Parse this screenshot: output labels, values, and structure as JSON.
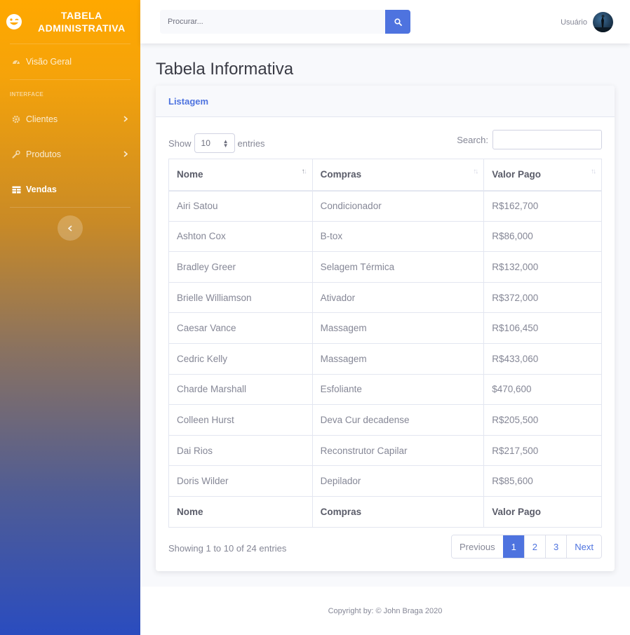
{
  "brand": {
    "line1": "TABELA",
    "line2": "ADMINISTRATIVA"
  },
  "sidebar": {
    "overview": "Visão Geral",
    "heading": "INTERFACE",
    "items": [
      {
        "label": "Clientes",
        "icon": "gear-icon",
        "has_chevron": true
      },
      {
        "label": "Produtos",
        "icon": "wrench-icon",
        "has_chevron": true
      },
      {
        "label": "Vendas",
        "icon": "table-icon",
        "active": true
      }
    ]
  },
  "topbar": {
    "search_placeholder": "Procurar...",
    "user_name": "Usuário"
  },
  "page": {
    "title": "Tabela Informativa"
  },
  "card": {
    "title": "Listagem",
    "length": {
      "show": "Show",
      "value": "10",
      "entries": "entries"
    },
    "search_label": "Search:",
    "columns": [
      "Nome",
      "Compras",
      "Valor Pago"
    ],
    "rows": [
      [
        "Airi Satou",
        "Condicionador",
        "R$162,700"
      ],
      [
        "Ashton Cox",
        "B-tox",
        "R$86,000"
      ],
      [
        "Bradley Greer",
        "Selagem Térmica",
        "R$132,000"
      ],
      [
        "Brielle Williamson",
        "Ativador",
        "R$372,000"
      ],
      [
        "Caesar Vance",
        "Massagem",
        "R$106,450"
      ],
      [
        "Cedric Kelly",
        "Massagem",
        "R$433,060"
      ],
      [
        "Charde Marshall",
        "Esfoliante",
        "$470,600"
      ],
      [
        "Colleen Hurst",
        "Deva Cur decadense",
        "R$205,500"
      ],
      [
        "Dai Rios",
        "Reconstrutor Capilar",
        "R$217,500"
      ],
      [
        "Doris Wilder",
        "Depilador",
        "R$85,600"
      ]
    ],
    "info": "Showing 1 to 10 of 24 entries",
    "pagination": {
      "previous": "Previous",
      "pages": [
        "1",
        "2",
        "3"
      ],
      "active": "1",
      "next": "Next"
    }
  },
  "footer": {
    "text": "Copyright by: © John Braga 2020"
  },
  "colors": {
    "primary": "#4e73df",
    "sidebar_top": "#ffa800",
    "sidebar_bottom": "#2a4cbf"
  }
}
